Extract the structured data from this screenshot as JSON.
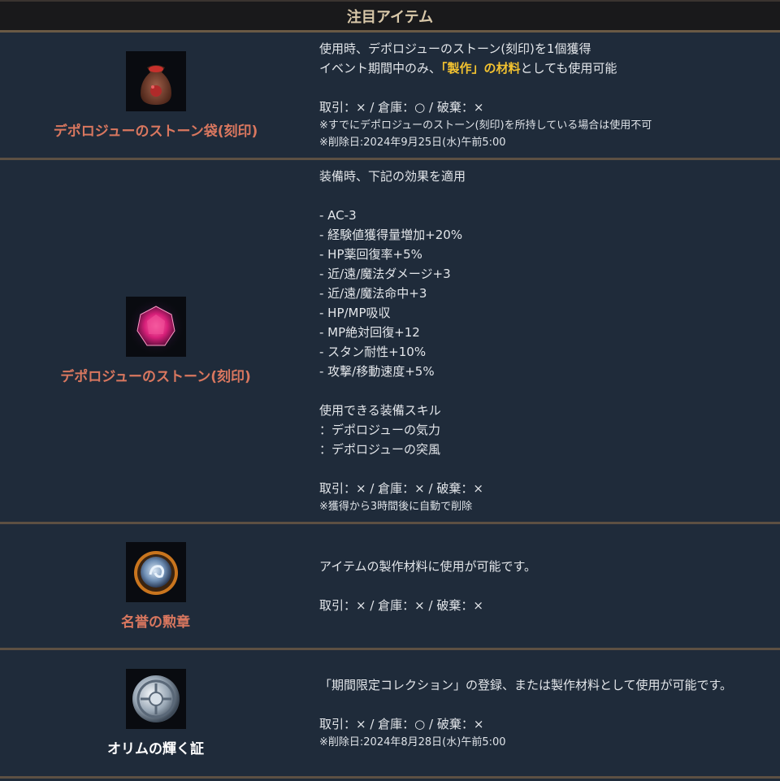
{
  "header": {
    "title": "注目アイテム"
  },
  "items": [
    {
      "name": "デポロジューのストーン袋(刻印)",
      "icon": "pouch-icon",
      "line1": "使用時、デポロジューのストーン(刻印)を1個獲得",
      "line2_pre": "イベント期間中のみ、",
      "line2_hl": "「製作」の材料",
      "line2_post": "としても使用可能",
      "trade": "取引：× / 倉庫：○ / 破棄：×",
      "note1": "※すでにデポロジューのストーン(刻印)を所持している場合は使用不可",
      "note2": "※削除日:2024年9月25日(水)午前5:00"
    },
    {
      "name": "デポロジューのストーン(刻印)",
      "icon": "gem-icon",
      "intro": "装備時、下記の効果を適用",
      "effects": [
        "- AC-3",
        "- 経験値獲得量増加+20%",
        "- HP薬回復率+5%",
        "- 近/遠/魔法ダメージ+3",
        "- 近/遠/魔法命中+3",
        "- HP/MP吸収",
        "- MP絶対回復+12",
        "- スタン耐性+10%",
        "- 攻撃/移動速度+5%"
      ],
      "skills_title": "使用できる装備スキル",
      "skills": [
        "：デポロジューの気力",
        "：デポロジューの突風"
      ],
      "trade": "取引：× / 倉庫：× / 破棄：×",
      "note1": "※獲得から3時間後に自動で削除"
    },
    {
      "name": "名誉の勲章",
      "icon": "medal-icon",
      "desc": "アイテムの製作材料に使用が可能です。",
      "trade": "取引：× / 倉庫：× / 破棄：×"
    },
    {
      "name": "オリムの輝く証",
      "icon": "coin-icon",
      "desc": "「期間限定コレクション」の登録、または製作材料として使用が可能です。",
      "trade": "取引：× / 倉庫：○ / 破棄：×",
      "note1": "※削除日:2024年8月28日(水)午前5:00"
    }
  ],
  "colors": {
    "accent_name": "#d9775f",
    "highlight": "#f2c230",
    "bg": "#1f2b3a"
  }
}
